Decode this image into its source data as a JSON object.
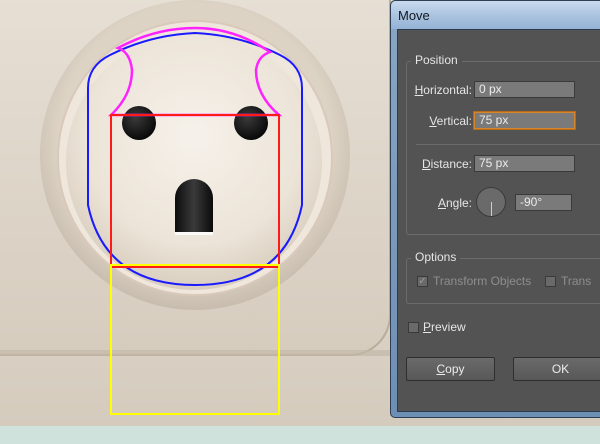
{
  "dialog": {
    "title": "Move",
    "position_group": "Position",
    "horizontal_label": "Horizontal:",
    "horizontal_value": "0 px",
    "vertical_label": "Vertical:",
    "vertical_value": "75 px",
    "distance_label": "Distance:",
    "distance_value": "75 px",
    "angle_label": "Angle:",
    "angle_value": "-90°",
    "options_group": "Options",
    "transform_objects_label": "Transform Objects",
    "transform_patterns_label": "Trans",
    "preview_label": "Preview",
    "copy_label": "Copy",
    "ok_label": "OK"
  },
  "colors": {
    "path_blue": "#1a1aff",
    "path_magenta": "#ff22ff",
    "path_red": "#ff1a1a",
    "path_yellow": "#ffff00",
    "dialog_bg": "#535353",
    "focus_orange": "#d6862a"
  }
}
